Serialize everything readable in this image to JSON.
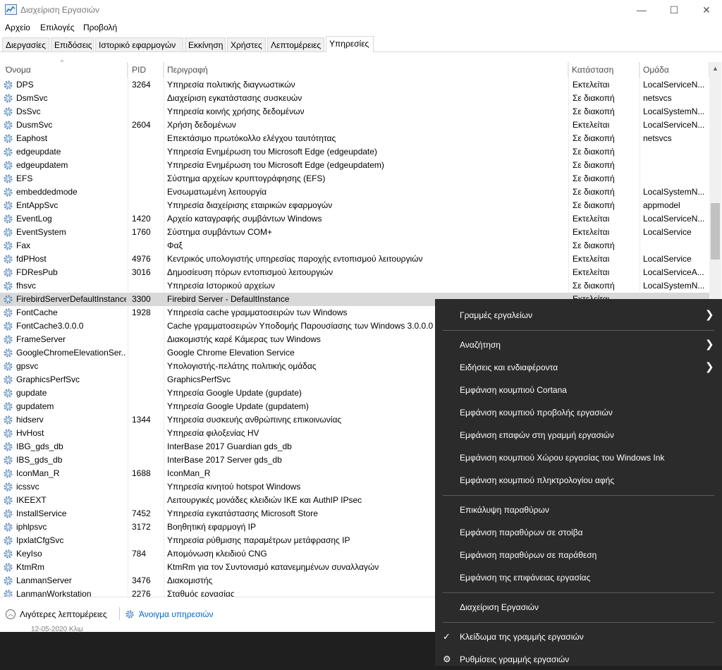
{
  "window": {
    "title": "Διαχείριση Εργασιών",
    "controls": {
      "minimize": "—",
      "maximize": "☐",
      "close": "✕"
    }
  },
  "menu": [
    "Αρχείο",
    "Επιλογές",
    "Προβολή"
  ],
  "tabs": [
    "Διεργασίες",
    "Επιδόσεις",
    "Ιστορικό εφαρμογών",
    "Εκκίνηση",
    "Χρήστες",
    "Λεπτομέρειες",
    "Υπηρεσίες"
  ],
  "active_tab": "Υπηρεσίες",
  "columns": [
    "Όνομα",
    "PID",
    "Περιγραφή",
    "Κατάσταση",
    "Ομάδα"
  ],
  "sort_indicator": "^",
  "rows": [
    {
      "name": "DPS",
      "pid": "3264",
      "desc": "Υπηρεσία πολιτικής διαγνωστικών",
      "status": "Εκτελείται",
      "group": "LocalServiceN..."
    },
    {
      "name": "DsmSvc",
      "pid": "",
      "desc": "Διαχείριση εγκατάστασης συσκευών",
      "status": "Σε διακοπή",
      "group": "netsvcs"
    },
    {
      "name": "DsSvc",
      "pid": "",
      "desc": "Υπηρεσία κοινής χρήσης δεδομένων",
      "status": "Σε διακοπή",
      "group": "LocalSystemN..."
    },
    {
      "name": "DusmSvc",
      "pid": "2604",
      "desc": "Χρήση δεδομένων",
      "status": "Εκτελείται",
      "group": "LocalServiceN..."
    },
    {
      "name": "Eaphost",
      "pid": "",
      "desc": "Επεκτάσιμο πρωτόκολλο ελέγχου ταυτότητας",
      "status": "Σε διακοπή",
      "group": "netsvcs"
    },
    {
      "name": "edgeupdate",
      "pid": "",
      "desc": "Υπηρεσία Ενημέρωση του Microsoft Edge (edgeupdate)",
      "status": "Σε διακοπή",
      "group": ""
    },
    {
      "name": "edgeupdatem",
      "pid": "",
      "desc": "Υπηρεσία Ενημέρωση του Microsoft Edge (edgeupdatem)",
      "status": "Σε διακοπή",
      "group": ""
    },
    {
      "name": "EFS",
      "pid": "",
      "desc": "Σύστημα αρχείων κρυπτογράφησης (EFS)",
      "status": "Σε διακοπή",
      "group": ""
    },
    {
      "name": "embeddedmode",
      "pid": "",
      "desc": "Ενσωματωμένη λειτουργία",
      "status": "Σε διακοπή",
      "group": "LocalSystemN..."
    },
    {
      "name": "EntAppSvc",
      "pid": "",
      "desc": "Υπηρεσία διαχείρισης εταιρικών εφαρμογών",
      "status": "Σε διακοπή",
      "group": "appmodel"
    },
    {
      "name": "EventLog",
      "pid": "1420",
      "desc": "Αρχείο καταγραφής συμβάντων Windows",
      "status": "Εκτελείται",
      "group": "LocalServiceN..."
    },
    {
      "name": "EventSystem",
      "pid": "1760",
      "desc": "Σύστημα συμβάντων COM+",
      "status": "Εκτελείται",
      "group": "LocalService"
    },
    {
      "name": "Fax",
      "pid": "",
      "desc": "Φαξ",
      "status": "Σε διακοπή",
      "group": ""
    },
    {
      "name": "fdPHost",
      "pid": "4976",
      "desc": "Κεντρικός υπολογιστής υπηρεσίας παροχής εντοπισμού λειτουργιών",
      "status": "Εκτελείται",
      "group": "LocalService"
    },
    {
      "name": "FDResPub",
      "pid": "3016",
      "desc": "Δημοσίευση πόρων εντοπισμού λειτουργιών",
      "status": "Εκτελείται",
      "group": "LocalServiceA..."
    },
    {
      "name": "fhsvc",
      "pid": "",
      "desc": "Υπηρεσία Ιστορικού αρχείων",
      "status": "Σε διακοπή",
      "group": "LocalSystemN..."
    },
    {
      "name": "FirebirdServerDefaultInstance",
      "pid": "3300",
      "desc": "Firebird Server - DefaultInstance",
      "status": "Εκτελείται",
      "group": ""
    },
    {
      "name": "FontCache",
      "pid": "1928",
      "desc": "Υπηρεσία cache γραμματοσειρών των Windows",
      "status": "",
      "group": ""
    },
    {
      "name": "FontCache3.0.0.0",
      "pid": "",
      "desc": "Cache γραμματοσειρών Υποδομής Παρουσίασης των Windows 3.0.0.0",
      "status": "",
      "group": ""
    },
    {
      "name": "FrameServer",
      "pid": "",
      "desc": "Διακομιστής καρέ Κάμερας των Windows",
      "status": "",
      "group": ""
    },
    {
      "name": "GoogleChromeElevationSer...",
      "pid": "",
      "desc": "Google Chrome Elevation Service",
      "status": "",
      "group": ""
    },
    {
      "name": "gpsvc",
      "pid": "",
      "desc": "Υπολογιστής-πελάτης πολιτικής ομάδας",
      "status": "",
      "group": ""
    },
    {
      "name": "GraphicsPerfSvc",
      "pid": "",
      "desc": "GraphicsPerfSvc",
      "status": "",
      "group": ""
    },
    {
      "name": "gupdate",
      "pid": "",
      "desc": "Υπηρεσία Google Update (gupdate)",
      "status": "",
      "group": ""
    },
    {
      "name": "gupdatem",
      "pid": "",
      "desc": "Υπηρεσία Google Update (gupdatem)",
      "status": "",
      "group": ""
    },
    {
      "name": "hidserv",
      "pid": "1344",
      "desc": "Υπηρεσία συσκευής ανθρώπινης επικοινωνίας",
      "status": "",
      "group": ""
    },
    {
      "name": "HvHost",
      "pid": "",
      "desc": "Υπηρεσία φιλοξενίας HV",
      "status": "",
      "group": ""
    },
    {
      "name": "IBG_gds_db",
      "pid": "",
      "desc": "InterBase 2017 Guardian gds_db",
      "status": "",
      "group": ""
    },
    {
      "name": "IBS_gds_db",
      "pid": "",
      "desc": "InterBase 2017 Server gds_db",
      "status": "",
      "group": ""
    },
    {
      "name": "IconMan_R",
      "pid": "1688",
      "desc": "IconMan_R",
      "status": "",
      "group": ""
    },
    {
      "name": "icssvc",
      "pid": "",
      "desc": "Υπηρεσία κινητού hotspot Windows",
      "status": "",
      "group": ""
    },
    {
      "name": "IKEEXT",
      "pid": "",
      "desc": "Λειτουργικές μονάδες κλειδιών IKE και AuthIP IPsec",
      "status": "",
      "group": ""
    },
    {
      "name": "InstallService",
      "pid": "7452",
      "desc": "Υπηρεσία εγκατάστασης Microsoft Store",
      "status": "",
      "group": ""
    },
    {
      "name": "iphlpsvc",
      "pid": "3172",
      "desc": "Βοηθητική εφαρμογή IP",
      "status": "",
      "group": ""
    },
    {
      "name": "IpxlatCfgSvc",
      "pid": "",
      "desc": "Υπηρεσία ρύθμισης παραμέτρων μετάφρασης IP",
      "status": "",
      "group": ""
    },
    {
      "name": "KeyIso",
      "pid": "784",
      "desc": "Απομόνωση κλειδιού CNG",
      "status": "",
      "group": ""
    },
    {
      "name": "KtmRm",
      "pid": "",
      "desc": "KtmRm για τον Συντονισμό κατανεμημένων συναλλαγών",
      "status": "",
      "group": ""
    },
    {
      "name": "LanmanServer",
      "pid": "3476",
      "desc": "Διακομιστής",
      "status": "",
      "group": ""
    },
    {
      "name": "LanmanWorkstation",
      "pid": "2276",
      "desc": "Σταθμός εργασίας",
      "status": "",
      "group": ""
    }
  ],
  "selected_row": "FirebirdServerDefaultInstance",
  "footer": {
    "fewer_details": "Λιγότερες λεπτομέρειες",
    "open_services": "Άνοιγμα υπηρεσιών"
  },
  "background_text": "12-05-2020 Κλιμ",
  "context_menu": {
    "items": [
      {
        "label": "Γραμμές εργαλείων",
        "submenu": true
      },
      {
        "separator": true
      },
      {
        "label": "Αναζήτηση",
        "submenu": true
      },
      {
        "label": "Ειδήσεις και ενδιαφέροντα",
        "submenu": true
      },
      {
        "label": "Εμφάνιση κουμπιού Cortana"
      },
      {
        "label": "Εμφάνιση κουμπιού προβολής εργασιών"
      },
      {
        "label": "Εμφάνιση επαφών στη γραμμή εργασιών"
      },
      {
        "label": "Εμφάνιση κουμπιού Χώρου εργασίας του Windows Ink"
      },
      {
        "label": "Εμφάνιση κουμπιού πληκτρολογίου αφής"
      },
      {
        "separator": true
      },
      {
        "label": "Επικάλυψη παραθύρων"
      },
      {
        "label": "Εμφάνιση παραθύρων σε στοίβα"
      },
      {
        "label": "Εμφάνιση παραθύρων σε παράθεση"
      },
      {
        "label": "Εμφάνιση της επιφάνειας εργασίας"
      },
      {
        "separator": true
      },
      {
        "label": "Διαχείριση Εργασιών"
      },
      {
        "separator": true
      },
      {
        "label": "Κλείδωμα της γραμμής εργασιών",
        "checked": true
      },
      {
        "label": "Ρυθμίσεις γραμμής εργασιών",
        "icon": "gear-icon"
      }
    ],
    "check_glyph": "✓",
    "gear_glyph": "⚙",
    "submenu_glyph": "❯"
  }
}
